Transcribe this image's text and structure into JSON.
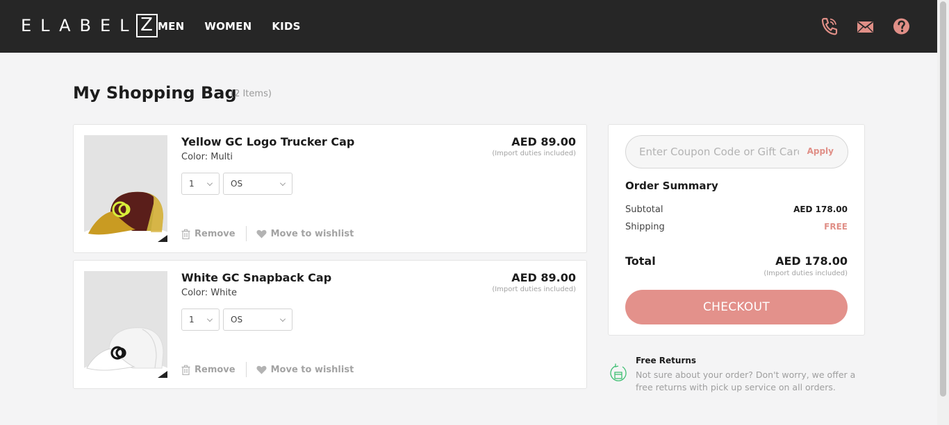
{
  "header": {
    "logo_text": "ELABEL",
    "logo_box": "Z",
    "nav": [
      "MEN",
      "WOMEN",
      "KIDS"
    ],
    "icons": [
      "phone-icon",
      "mail-icon",
      "help-icon"
    ],
    "icon_color": "#e08f87"
  },
  "bag": {
    "title": "My Shopping Bag",
    "count": "(2 Items)"
  },
  "items": [
    {
      "name": "Yellow GC Logo Trucker Cap",
      "color": "Color: Multi",
      "qty": "1",
      "size": "OS",
      "price": "AED 89.00",
      "duty": "(Import duties included)",
      "remove": "Remove",
      "wishlist": "Move to wishlist",
      "image": "yellow-trucker-cap"
    },
    {
      "name": "White GC Snapback Cap",
      "color": "Color: White",
      "qty": "1",
      "size": "OS",
      "price": "AED 89.00",
      "duty": "(Import duties included)",
      "remove": "Remove",
      "wishlist": "Move to wishlist",
      "image": "white-snapback-cap"
    }
  ],
  "summary": {
    "coupon_placeholder": "Enter Coupon Code or Gift Card",
    "apply": "Apply",
    "title": "Order Summary",
    "subtotal_label": "Subtotal",
    "subtotal": "AED 178.00",
    "shipping_label": "Shipping",
    "shipping": "FREE",
    "total_label": "Total",
    "total": "AED 178.00",
    "duty": "(Import duties included)",
    "checkout": "CHECKOUT"
  },
  "returns": {
    "title": "Free Returns",
    "text": "Not sure about your order? Don't worry, we offer a free returns with pick up service on all orders."
  },
  "colors": {
    "accent": "#e3918b",
    "header_bg": "#262626",
    "page_bg": "#f4f4f5",
    "returns_icon": "#3fbf73"
  }
}
